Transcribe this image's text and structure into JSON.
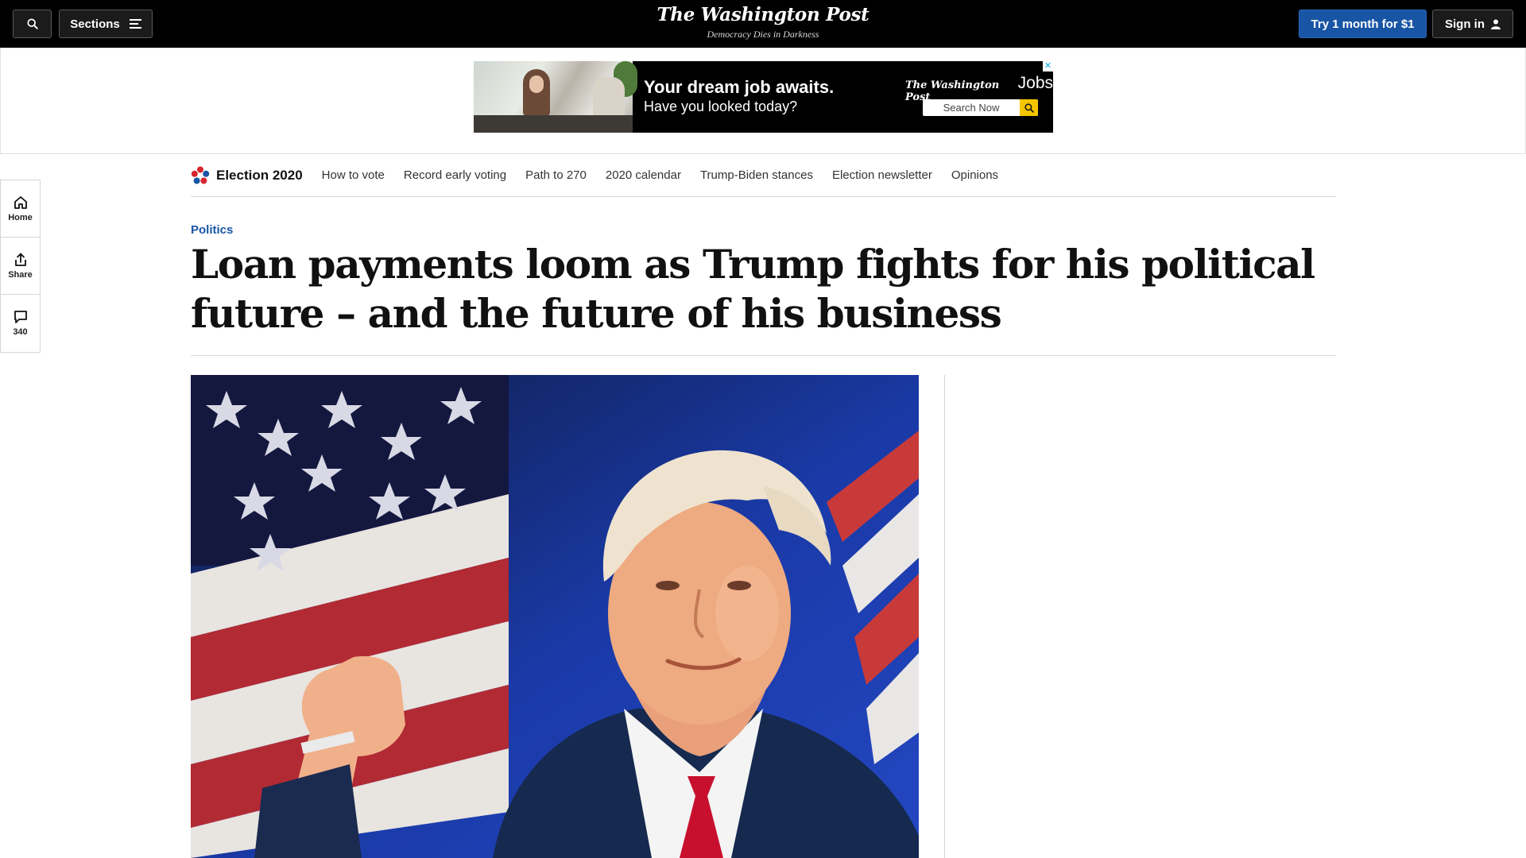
{
  "topbar": {
    "sections_label": "Sections",
    "masthead": "The Washington Post",
    "tagline": "Democracy Dies in Darkness",
    "try_label": "Try 1 month for $1",
    "signin_label": "Sign in"
  },
  "ad": {
    "headline": "Your dream job awaits.",
    "subline": "Have you looked today?",
    "brand": "The Washington Post",
    "brand_product": "Jobs",
    "search_label": "Search Now",
    "close_glyph": "✕"
  },
  "election_nav": {
    "brand": "Election 2020",
    "items": [
      "How to vote",
      "Record early voting",
      "Path to 270",
      "2020 calendar",
      "Trump-Biden stances",
      "Election newsletter",
      "Opinions"
    ]
  },
  "rail": {
    "home_label": "Home",
    "share_label": "Share",
    "comments_count": "340"
  },
  "article": {
    "kicker": "Politics",
    "headline": "Loan payments loom as Trump fights for his political future – and the future of his business"
  },
  "colors": {
    "topbar_bg": "#000000",
    "accent_blue": "#1955a5",
    "ad_search_button": "#f5c400"
  },
  "icons": [
    "search-icon",
    "menu-icon",
    "user-icon",
    "home-icon",
    "share-icon",
    "comment-icon",
    "election-star-icon",
    "close-icon"
  ]
}
